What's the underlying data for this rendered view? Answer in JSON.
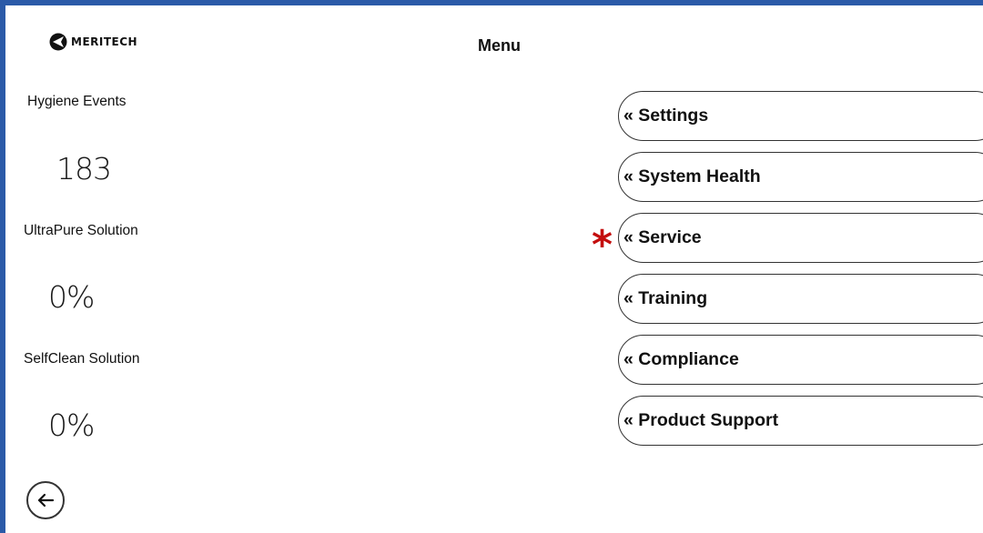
{
  "header": {
    "logo_text": "MERITECH",
    "title": "Menu"
  },
  "stats": [
    {
      "label": "Hygiene Events",
      "value": "183"
    },
    {
      "label": "UltraPure Solution",
      "value": "0%"
    },
    {
      "label": "SelfClean Solution",
      "value": "0%"
    }
  ],
  "menu": {
    "items": [
      {
        "label": "« Settings"
      },
      {
        "label": "« System Health"
      },
      {
        "label": "« Service"
      },
      {
        "label": "« Training"
      },
      {
        "label": "« Compliance"
      },
      {
        "label": "« Product Support"
      }
    ],
    "marker": "*",
    "marker_color": "#c40e0e"
  },
  "footer": {
    "back_icon": "arrow-left-icon"
  },
  "colors": {
    "frame_border": "#2b5aa8"
  }
}
